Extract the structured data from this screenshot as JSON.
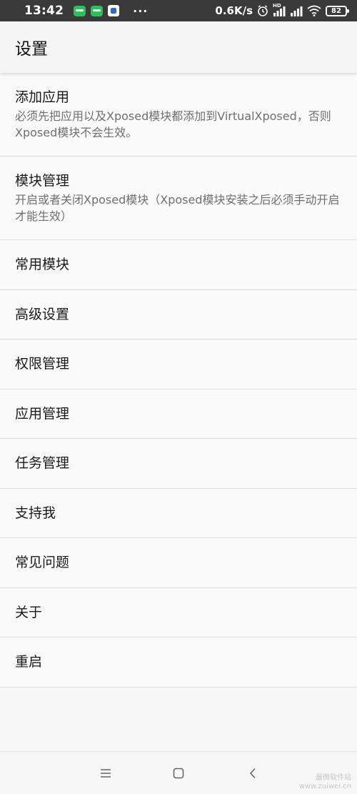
{
  "status_bar": {
    "time": "13:42",
    "more": "···",
    "net_speed": "0.6K/s",
    "network_badge": "HD",
    "battery": "82",
    "icons": [
      "chat-icon",
      "chat-icon",
      "app-icon",
      "alarm-icon",
      "signal-icon",
      "signal-icon",
      "wifi-icon",
      "battery-icon"
    ]
  },
  "app_bar": {
    "title": "设置"
  },
  "settings": {
    "items": [
      {
        "label": "添加应用",
        "desc": "必须先把应用以及Xposed模块都添加到VirtualXposed，否则Xposed模块不会生效。"
      },
      {
        "label": "模块管理",
        "desc": "开启或者关闭Xposed模块（Xposed模块安装之后必须手动开启才能生效）"
      },
      {
        "label": "常用模块"
      },
      {
        "label": "高级设置"
      },
      {
        "label": "权限管理"
      },
      {
        "label": "应用管理"
      },
      {
        "label": "任务管理"
      },
      {
        "label": "支持我"
      },
      {
        "label": "常见问题"
      },
      {
        "label": "关于"
      },
      {
        "label": "重启"
      }
    ]
  },
  "nav_bar": {
    "buttons": [
      "menu-icon",
      "home-icon",
      "back-icon"
    ]
  },
  "watermark": {
    "line1": "最微软件站",
    "line2": "www.zuiwei.cn"
  },
  "colors": {
    "status_bar_bg": "#3a3a3a",
    "app_bar_bg": "#f5f5f5",
    "list_bg": "#fafafa",
    "divider": "#dddddd",
    "primary_text": "#1a1a1a",
    "secondary_text": "#6f6f6f"
  }
}
